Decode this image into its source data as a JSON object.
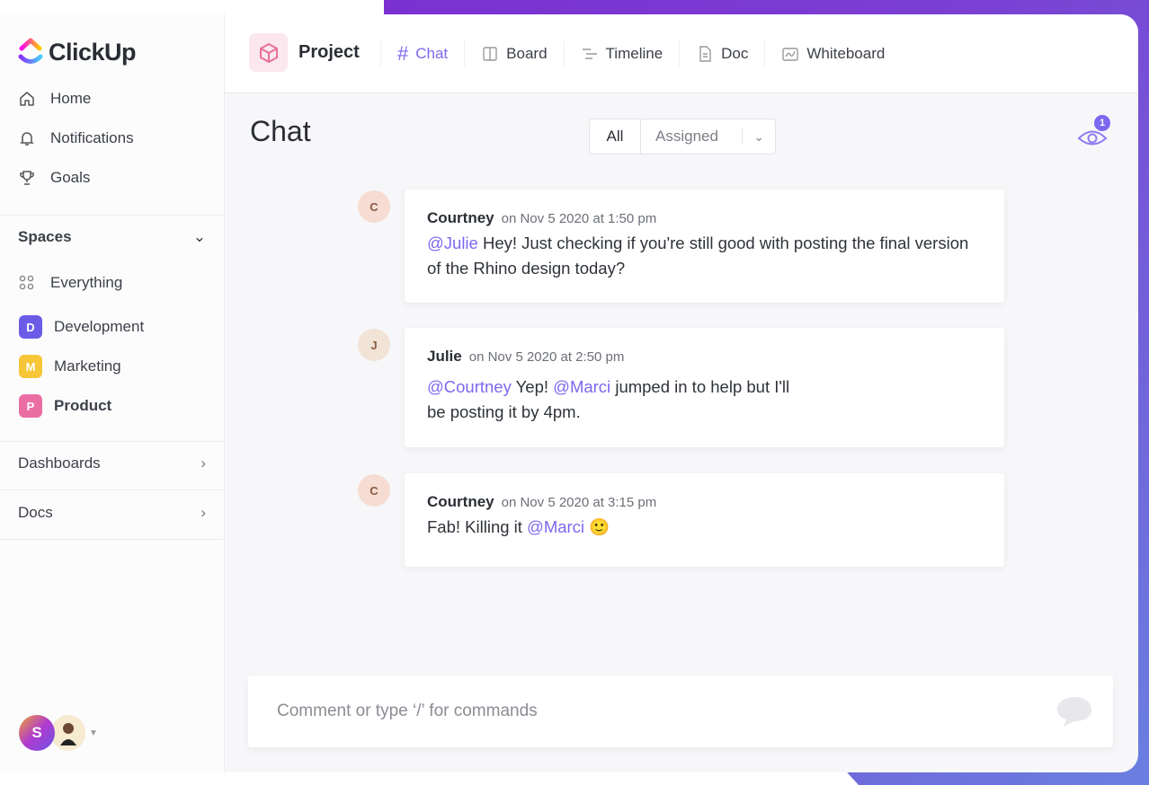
{
  "brand": {
    "name": "ClickUp"
  },
  "sidebar": {
    "nav": [
      {
        "label": "Home",
        "icon": "home-icon"
      },
      {
        "label": "Notifications",
        "icon": "bell-icon"
      },
      {
        "label": "Goals",
        "icon": "trophy-icon"
      }
    ],
    "spaces_label": "Spaces",
    "everything": "Everything",
    "spaces": [
      {
        "initial": "D",
        "label": "Development",
        "color": "#6b5ce7"
      },
      {
        "initial": "M",
        "label": "Marketing",
        "color": "#f7c638"
      },
      {
        "initial": "P",
        "label": "Product",
        "color": "#ea6ea4"
      }
    ],
    "dashboards": "Dashboards",
    "docs": "Docs",
    "user_initial": "S"
  },
  "header": {
    "project": "Project",
    "tabs": [
      {
        "label": "Chat",
        "icon": "hash-icon"
      },
      {
        "label": "Board",
        "icon": "board-icon"
      },
      {
        "label": "Timeline",
        "icon": "timeline-icon"
      },
      {
        "label": "Doc",
        "icon": "doc-icon"
      },
      {
        "label": "Whiteboard",
        "icon": "whiteboard-icon"
      }
    ]
  },
  "main": {
    "title": "Chat",
    "filter": {
      "all": "All",
      "assigned": "Assigned"
    },
    "watchers_count": "1",
    "messages": [
      {
        "author": "Courtney",
        "time": "on Nov 5 2020 at 1:50 pm",
        "mentions": [
          "@Julie"
        ],
        "text": " Hey! Just checking if you're still good with posting the final version of the Rhino design today?"
      },
      {
        "author": "Julie",
        "time": "on Nov 5 2020 at 2:50 pm",
        "mentions": [
          "@Courtney",
          "@Marci"
        ],
        "text1": " Yep! ",
        "text2": " jumped in to help but I'll",
        "text3": "be posting it by 4pm."
      },
      {
        "author": "Courtney",
        "time": "on Nov 5 2020 at 3:15 pm",
        "text": "Fab! Killing it ",
        "mentions": [
          "@Marci"
        ],
        "emoji": "🙂"
      }
    ],
    "comment_placeholder": "Comment or type ‘/’ for commands"
  },
  "colors": {
    "accent": "#7b68ee"
  }
}
